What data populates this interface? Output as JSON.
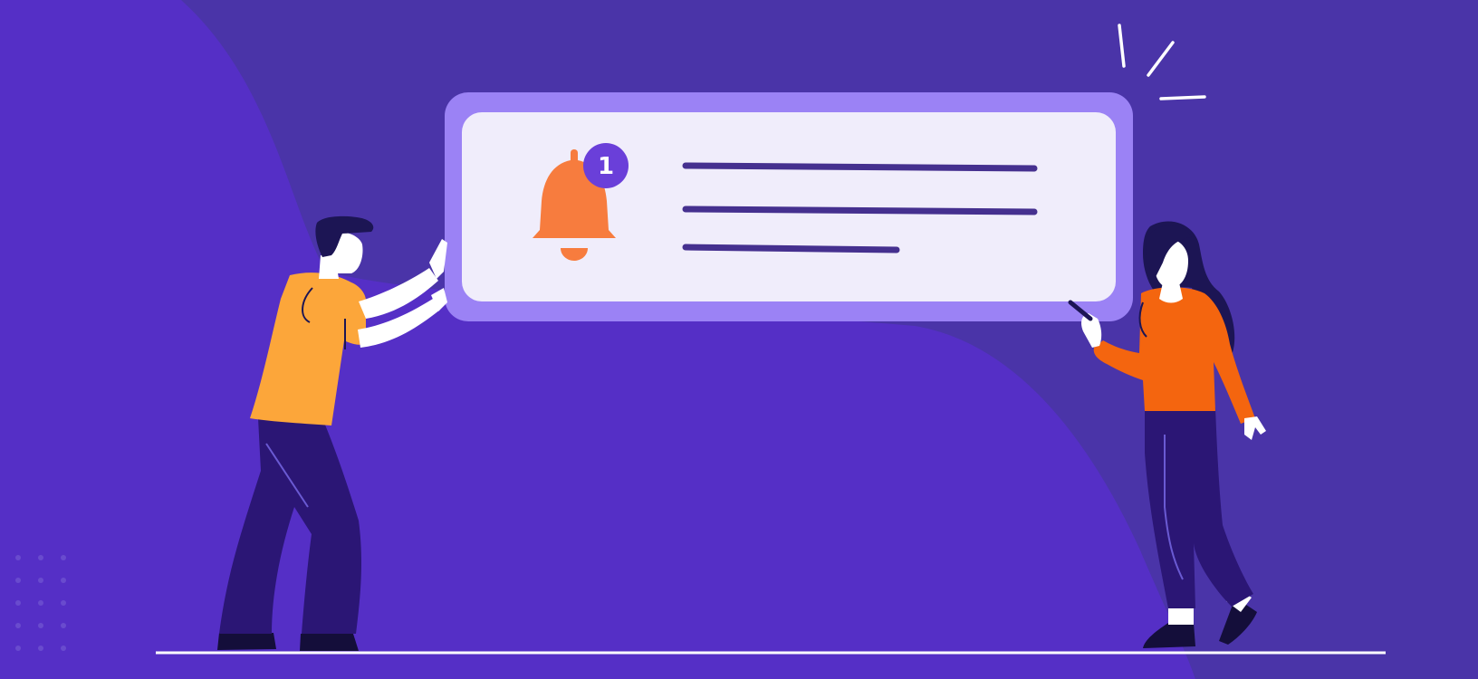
{
  "notification": {
    "badge_count": "1",
    "icon": "bell-icon",
    "text_line_count": 3
  },
  "colors": {
    "background_main": "#552fc6",
    "background_shade": "#4a34a8",
    "card_border": "#9b82f5",
    "card_fill": "#f0edfb",
    "text_lines": "#45308f",
    "bell": "#f77c3e",
    "badge": "#6a3fd9",
    "badge_text": "#ffffff",
    "man_shirt": "#fca63a",
    "woman_shirt": "#f4650f",
    "pants": "#2b1675",
    "hair": "#1c1554",
    "shoes": "#140e3a",
    "skin": "#ffffff",
    "ground_line": "#ffffff"
  },
  "figures": {
    "left": "man-pushing-card",
    "right": "woman-holding-phone"
  }
}
